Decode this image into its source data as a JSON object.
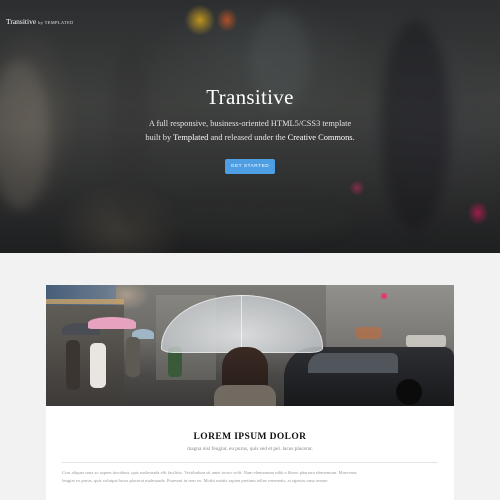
{
  "header": {
    "logo_name": "Transitive",
    "logo_by": "by TEMPLATED"
  },
  "hero": {
    "title": "Transitive",
    "subtitle_line1": "A full responsive, business-oriented HTML5/CSS3 template",
    "subtitle_pre": "built by ",
    "subtitle_link1": "Templated",
    "subtitle_mid": " and released under the ",
    "subtitle_link2": "Creative Commons",
    "subtitle_end": ".",
    "cta_label": "GET STARTED"
  },
  "feature": {
    "title": "LOREM IPSUM DOLOR",
    "subtitle": "magna nisi feugiat, eu purus, quis sed et pel. lacus placerat.",
    "paragraph_line1": "Cras aliquet urna ac sapien tincidunt, quis malesuada elit facilisis. Vestibulum sit amet tortor velit. Nam elementum nibh a libero pharetra elementum. Maecenas",
    "paragraph_line2": "feugiat ex purus, quis volutpat lacus placerat malesuada. Praesent in sem ex. Morbi mattis sapien pretium tellus venenatis, at egestas urna ornare."
  },
  "colors": {
    "cta_background": "#4e9ee3",
    "page_background": "#f2f2f2",
    "card_background": "#ffffff"
  }
}
